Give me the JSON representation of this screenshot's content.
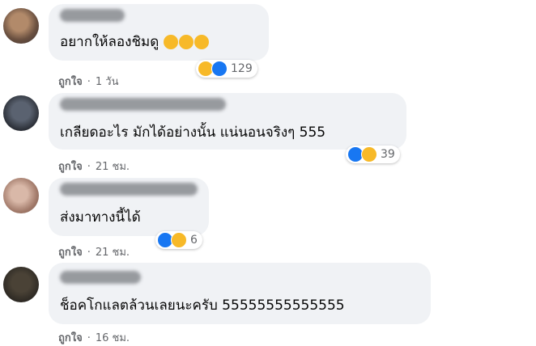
{
  "comments": [
    {
      "text": "อยากให้ลองชิมดู",
      "meta": {
        "like": "ถูกใจ",
        "dot": "·",
        "time": "1 วัน"
      },
      "reactions": {
        "count": "129",
        "icons": [
          "haha-icon",
          "like-icon"
        ]
      },
      "inline_emojis": [
        "rofl-emoji",
        "rofl-emoji",
        "rofl-emoji"
      ]
    },
    {
      "text": "เกลียดอะไร มักได้อย่างนั้น แน่นอนจริงๆ 555",
      "meta": {
        "like": "ถูกใจ",
        "dot": "·",
        "time": "21 ชม."
      },
      "reactions": {
        "count": "39",
        "icons": [
          "like-icon",
          "haha-icon"
        ]
      }
    },
    {
      "text": "ส่งมาทางนี้ได้",
      "meta": {
        "like": "ถูกใจ",
        "dot": "·",
        "time": "21 ชม."
      },
      "reactions": {
        "count": "6",
        "icons": [
          "like-icon",
          "haha-icon"
        ]
      }
    },
    {
      "text": "ช็อคโกแลตล้วนเลยนะครับ 55555555555555",
      "meta": {
        "like": "ถูกใจ",
        "dot": "·",
        "time": "16 ชม."
      }
    }
  ],
  "colors": {
    "bubble": "#f0f2f5",
    "meta_text": "#65676b",
    "like_blue": "#1877f2",
    "haha_yellow": "#f7b928"
  }
}
